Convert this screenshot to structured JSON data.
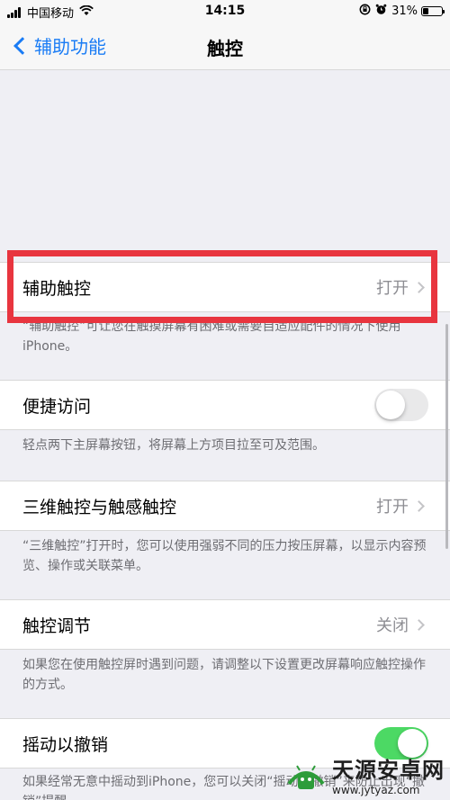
{
  "status_bar": {
    "carrier": "中国移动",
    "time": "14:15",
    "battery_percent": "31%",
    "battery_level": 0.31
  },
  "nav": {
    "back_label": "辅助功能",
    "title": "触控"
  },
  "rows": {
    "assistive_touch": {
      "label": "辅助触控",
      "value": "打开"
    },
    "assistive_touch_footnote": "“辅助触控”可让您在触摸屏幕有困难或需要自适应配件的情况下使用iPhone。",
    "reachability": {
      "label": "便捷访问",
      "toggle_on": false
    },
    "reachability_footnote": "轻点两下主屏幕按钮，将屏幕上方项目拉至可及范围。",
    "touch_3d": {
      "label": "三维触控与触感触控",
      "value": "打开"
    },
    "touch_3d_footnote": "“三维触控”打开时，您可以使用强弱不同的压力按压屏幕，以显示内容预览、操作或关联菜单。",
    "touch_accommodations": {
      "label": "触控调节",
      "value": "关闭"
    },
    "touch_accommodations_footnote": "如果您在使用触控屏时遇到问题，请调整以下设置更改屏幕响应触控操作的方式。",
    "shake_to_undo": {
      "label": "摇动以撤销",
      "toggle_on": true
    },
    "shake_to_undo_footnote": "如果经常无意中摇动到iPhone，您可以关闭“摇动以撤销”来防止出现“撤销”提醒。"
  },
  "colors": {
    "accent": "#1a7cf5",
    "toggle_on": "#4cd964",
    "highlight": "#e8353f"
  },
  "watermark": {
    "title": "天源安卓网",
    "url": "www.jytyaz.com"
  }
}
